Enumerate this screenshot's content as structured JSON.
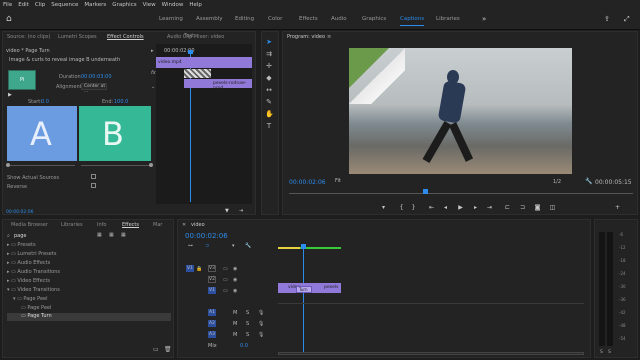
{
  "menu": [
    "File",
    "Edit",
    "Clip",
    "Sequence",
    "Markers",
    "Graphics",
    "View",
    "Window",
    "Help"
  ],
  "workspaces": [
    "Learning",
    "Assembly",
    "Editing",
    "Color",
    "Effects",
    "Audio",
    "Graphics",
    "Captions",
    "Libraries"
  ],
  "active_workspace": "Captions",
  "source_panel": {
    "tabs": [
      "Source: (no clips)",
      "Lumetri Scopes",
      "Effect Controls",
      "Audio Clip Mixer: video"
    ],
    "active_tab": "Effect Controls",
    "clip_path": "video * Page Turn",
    "effect_desc": "Image & curls to reveal image B underneath",
    "thumb_label": "Pi",
    "duration_label": "Duration",
    "duration_value": "00:00:03:00",
    "alignment_label": "Alignment",
    "alignment_value": "Center at ...",
    "start_label": "Start:",
    "start_value": "0.0",
    "end_label": "End:",
    "end_value": "100.0",
    "a_label": "A",
    "b_label": "B",
    "show_sources": "Show Actual Sources",
    "reverse": "Reverse",
    "mini_time": "00:00:02:00",
    "clip_a": "video.mp4",
    "clip_b": "pexels-rodnae-prod",
    "timecode": "00:00:02:06"
  },
  "text_tab": "Text",
  "program": {
    "title": "Program: video",
    "timecode": "00:00:02:06",
    "fit": "Fit",
    "fraction": "1/2",
    "duration": "00:00:05:15"
  },
  "project": {
    "tabs": [
      "Media Browser",
      "Libraries",
      "Info",
      "Effects",
      "Mar"
    ],
    "active_tab": "Effects",
    "search": "page",
    "tree": [
      "Presets",
      "Lumetri Presets",
      "Audio Effects",
      "Audio Transitions",
      "Video Effects",
      "Video Transitions",
      "Page Peel",
      "Page Peel",
      "Page Turn"
    ]
  },
  "timeline": {
    "title": "video",
    "timecode": "00:00:02:06",
    "video_tracks": [
      "V3",
      "V2",
      "V1"
    ],
    "audio_tracks": [
      "A1",
      "A2",
      "A3"
    ],
    "mix_label": "Mix",
    "mix_value": "0.0",
    "clip_v1a": "video",
    "clip_v1b": "pexels",
    "transition": "Turn",
    "source_v1": "V1"
  },
  "meter_labels": [
    "-6",
    "-12",
    "-18",
    "-24",
    "-30",
    "-36",
    "-42",
    "-48",
    "-54"
  ],
  "meter_footer": [
    "S",
    "S"
  ]
}
